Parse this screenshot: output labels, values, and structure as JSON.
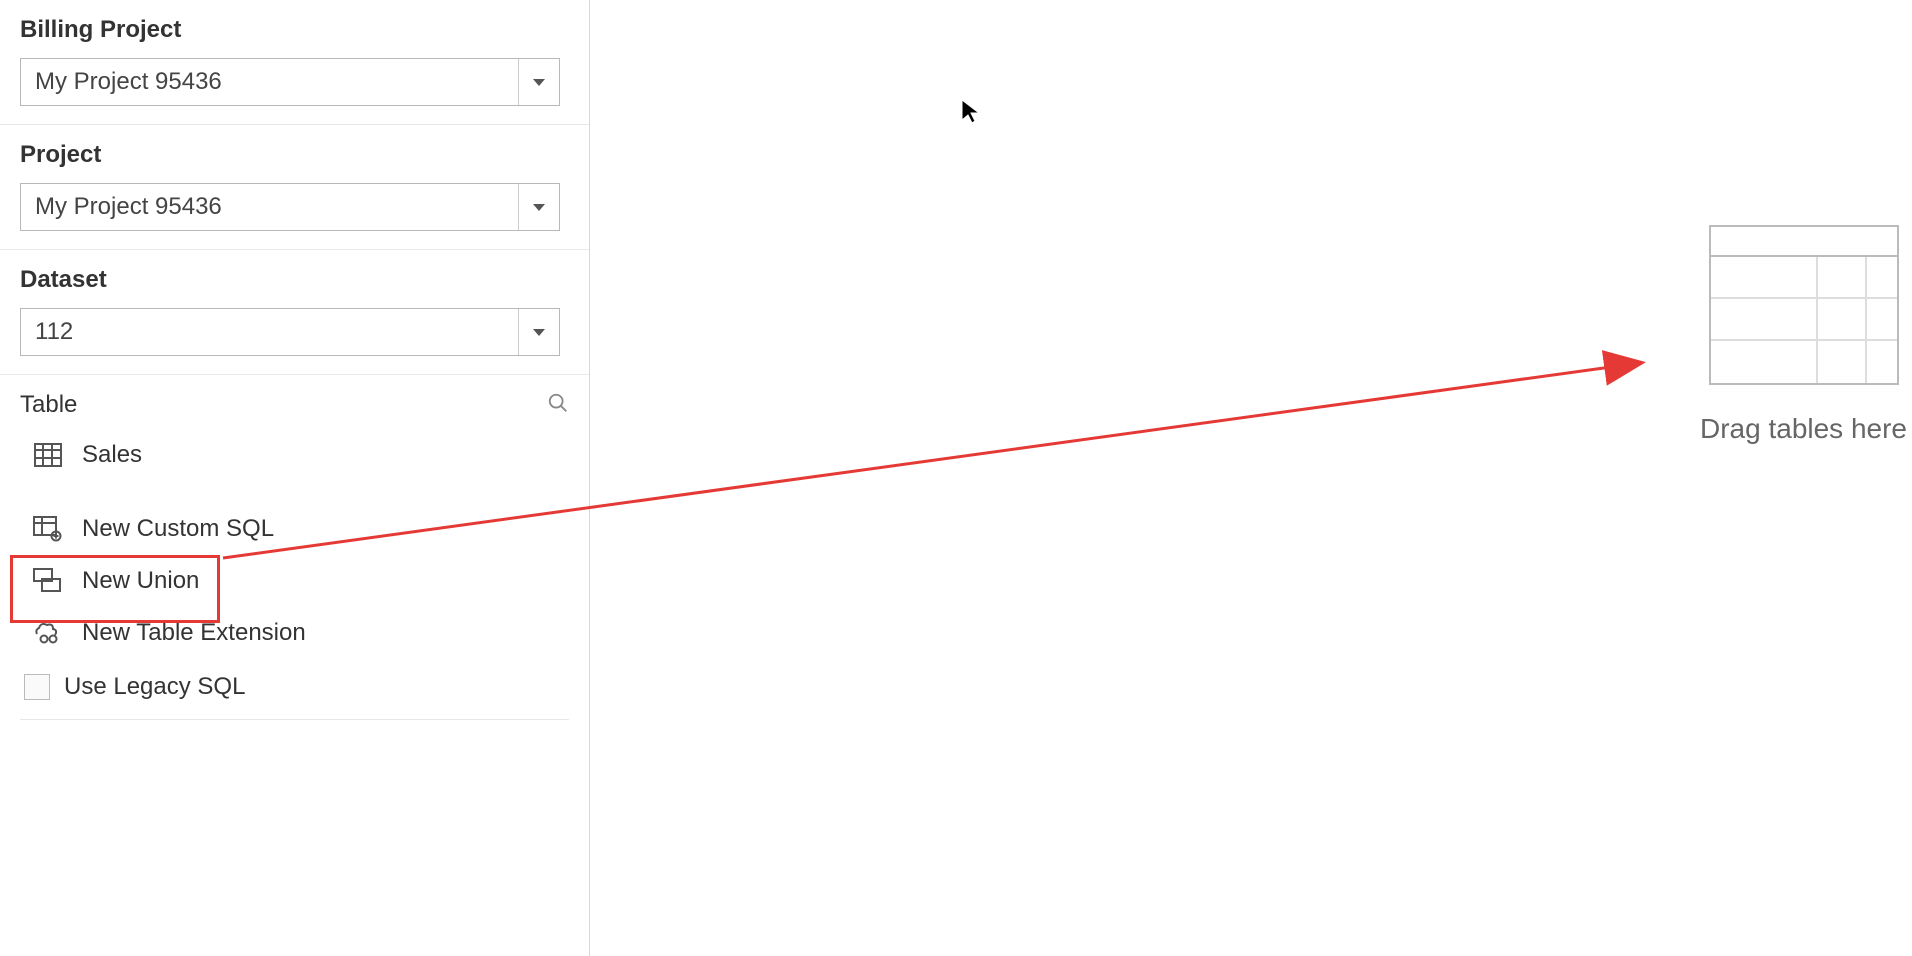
{
  "sidebar": {
    "billing_project": {
      "label": "Billing Project",
      "value": "My Project 95436"
    },
    "project": {
      "label": "Project",
      "value": "My Project 95436"
    },
    "dataset": {
      "label": "Dataset",
      "value": "112"
    },
    "table_section": {
      "label": "Table"
    },
    "tables": [
      {
        "label": "Sales"
      }
    ],
    "actions": {
      "custom_sql": "New Custom SQL",
      "union": "New Union",
      "table_extension": "New Table Extension"
    },
    "use_legacy_sql": {
      "label": "Use Legacy SQL",
      "checked": false
    }
  },
  "canvas": {
    "drop_hint": "Drag tables here"
  }
}
